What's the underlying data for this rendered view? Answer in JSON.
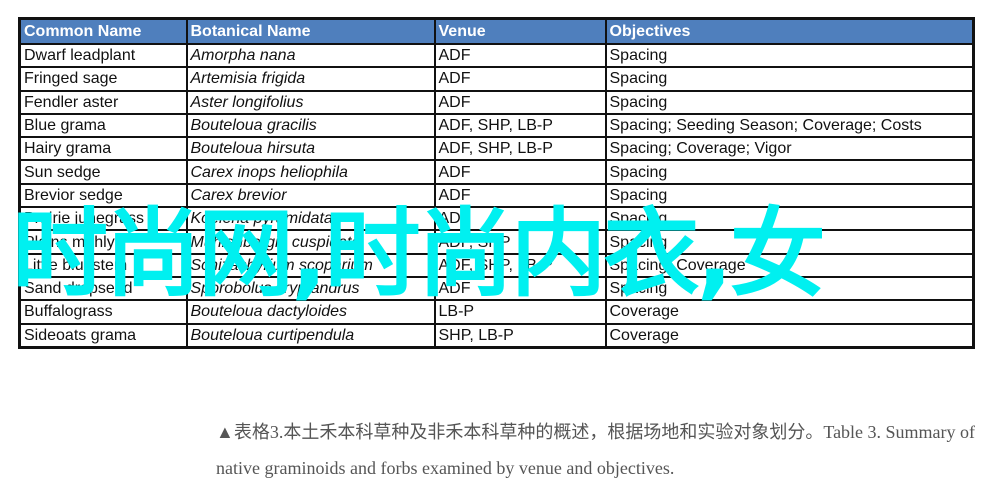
{
  "table": {
    "headers": [
      "Common Name",
      "Botanical  Name",
      "Venue",
      "Objectives"
    ],
    "rows": [
      {
        "common": "Dwarf leadplant",
        "botanical": "Amorpha nana",
        "venue": "ADF",
        "objectives": "Spacing"
      },
      {
        "common": "Fringed sage",
        "botanical": "Artemisia frigida",
        "venue": "ADF",
        "objectives": "Spacing"
      },
      {
        "common": "Fendler aster",
        "botanical": "Aster longifolius",
        "venue": "ADF",
        "objectives": "Spacing"
      },
      {
        "common": "Blue grama",
        "botanical": "Bouteloua gracilis",
        "venue": "ADF, SHP, LB-P",
        "objectives": "Spacing; Seeding Season;  Coverage; Costs"
      },
      {
        "common": "Hairy grama",
        "botanical": "Bouteloua hirsuta",
        "venue": "ADF, SHP, LB-P",
        "objectives": "Spacing; Coverage; Vigor"
      },
      {
        "common": "Sun sedge",
        "botanical": "Carex inops heliophila",
        "venue": "ADF",
        "objectives": "Spacing"
      },
      {
        "common": "Brevior sedge",
        "botanical": "Carex brevior",
        "venue": "ADF",
        "objectives": "Spacing"
      },
      {
        "common": "Prairie junegrass",
        "botanical": "Koeleria pyramidata",
        "venue": "ADF",
        "objectives": "Spacing"
      },
      {
        "common": "Plains muhly",
        "botanical": "Muhlenbergia cuspidata",
        "venue": "ADF, SHP",
        "objectives": "Spacing"
      },
      {
        "common": "Little bluestem",
        "botanical": "Schizachyrium scoparium",
        "venue": "ADF, SHP, LB-P",
        "objectives": "Spacing; Coverage"
      },
      {
        "common": "Sand dropseed",
        "botanical": "Sporobolus cryptandrus",
        "venue": "ADF",
        "objectives": "Spacing"
      },
      {
        "common": "Buffalograss",
        "botanical": "Bouteloua dactyloides",
        "venue": "LB-P",
        "objectives": "Coverage"
      },
      {
        "common": "Sideoats grama",
        "botanical": "Bouteloua curtipendula",
        "venue": "SHP, LB-P",
        "objectives": "Coverage"
      }
    ]
  },
  "watermark": {
    "text": "时尚网,时尚内衣,女",
    "color": "#00f0f0"
  },
  "caption": {
    "marker_icon": "triangle-up",
    "text": "表格3.本土禾本科草种及非禾本科草种的概述，根据场地和实验对象划分。Table 3. Summary of native graminoids and forbs examined by venue and objectives."
  },
  "colors": {
    "header_bg": "#4f7fbd",
    "header_text": "#ffffff",
    "border": "#111111",
    "caption_text": "#555555"
  }
}
